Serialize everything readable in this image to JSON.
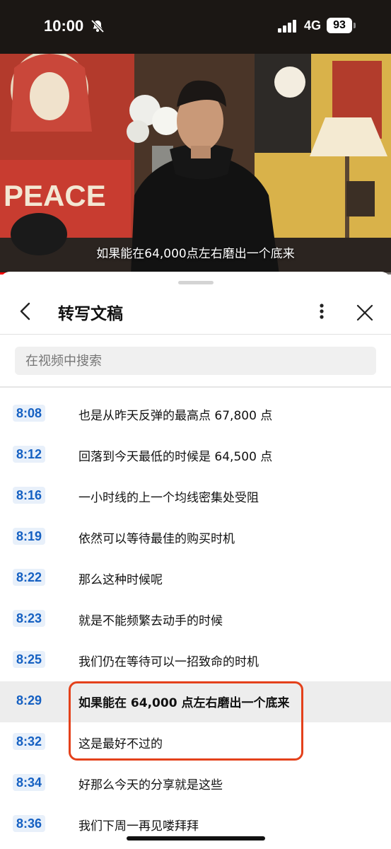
{
  "status_bar": {
    "time": "10:00",
    "network": "4G",
    "battery": "93"
  },
  "video": {
    "caption": "如果能在64,000点左右磨出一个底来",
    "progress": 0.98,
    "accent_color": "#ff0000"
  },
  "panel": {
    "title": "转写文稿",
    "search_placeholder": "在视频中搜索"
  },
  "transcript": [
    {
      "time": "8:08",
      "text": "也是从昨天反弹的最高点 67,800 点"
    },
    {
      "time": "8:12",
      "text": "回落到今天最低的时候是 64,500 点"
    },
    {
      "time": "8:16",
      "text": "一小时线的上一个均线密集处受阻"
    },
    {
      "time": "8:19",
      "text": "依然可以等待最佳的购买时机"
    },
    {
      "time": "8:22",
      "text": "那么这种时候呢"
    },
    {
      "time": "8:23",
      "text": "就是不能频繁去动手的时候"
    },
    {
      "time": "8:25",
      "text": "我们仍在等待可以一招致命的时机"
    },
    {
      "time": "8:29",
      "text": "如果能在 64,000 点左右磨出一个底来",
      "active": true
    },
    {
      "time": "8:32",
      "text": "这是最好不过的"
    },
    {
      "time": "8:34",
      "text": "好那么今天的分享就是这些"
    },
    {
      "time": "8:36",
      "text": "我们下周一再见喽拜拜"
    }
  ],
  "colors": {
    "timestamp": "#1560c2",
    "highlight_border": "#e4411b"
  }
}
